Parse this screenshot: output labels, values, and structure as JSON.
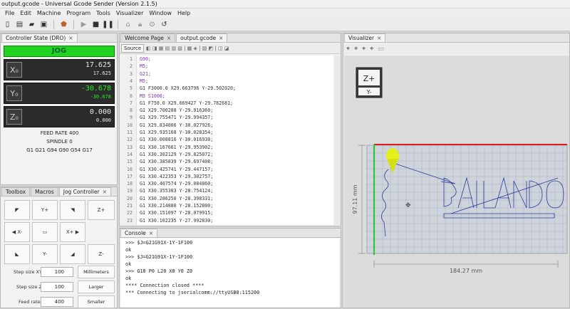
{
  "window": {
    "title": "output.gcode - Universal Gcode Sender (Version 2.1.5)"
  },
  "menu": [
    "File",
    "Edit",
    "Machine",
    "Program",
    "Tools",
    "Visualizer",
    "Window",
    "Help"
  ],
  "toolbar_icons": [
    "new-file-icon",
    "open-file-icon",
    "open-folder-icon",
    "save-icon",
    "stop-sign-icon",
    "play-icon",
    "stop-icon",
    "pause-icon",
    "home-icon",
    "lock-icon",
    "unlock-icon",
    "reset-icon"
  ],
  "controller": {
    "tab": "Controller State (DRO)",
    "state": "JOG",
    "axes": [
      {
        "label": "X₀",
        "work": "17.625",
        "machine": "17.625"
      },
      {
        "label": "Y₀",
        "work": "-30.678",
        "machine": "-30.678"
      },
      {
        "label": "Z₀",
        "work": "0.000",
        "machine": "0.000"
      }
    ],
    "feed_rate_label": "FEED RATE",
    "feed_rate": "400",
    "spindle_label": "SPINDLE",
    "spindle": "0",
    "gcode_state": "G1 G21 G94 G90 G54 G17",
    "colors": {
      "state_bg": "#21d421",
      "work_x": "#e8e8e8",
      "work_y": "#22ee22"
    }
  },
  "jog": {
    "tabs": [
      "Toolbox",
      "Macros",
      "Jog Controller"
    ],
    "buttons": {
      "y_plus": "Y+",
      "z_plus": "Z+",
      "x_minus": "X-",
      "x_plus": "X+",
      "y_minus": "Y-",
      "z_minus": "Z-"
    },
    "step_xy_label": "Step size XY",
    "step_xy": "100",
    "step_z_label": "Step size Z",
    "step_z": "100",
    "feed_label": "Feed rate",
    "feed": "400",
    "units_button": "Millimeters",
    "larger_button": "Larger",
    "smaller_button": "Smaller"
  },
  "editor": {
    "tabs": [
      "Welcome Page",
      "output.gcode"
    ],
    "source_label": "Source",
    "lines": [
      {
        "n": "1",
        "code": "G90;",
        "c": "#7a2fa8"
      },
      {
        "n": "2",
        "code": "M5;",
        "c": "#7a2fa8"
      },
      {
        "n": "3",
        "code": "G21;",
        "c": "#7a2fa8"
      },
      {
        "n": "4",
        "code": "M5;",
        "c": "#7a2fa8"
      },
      {
        "n": "5",
        "code": "G1 F3000.0 X29.663796 Y-29.502020;",
        "c": "#333"
      },
      {
        "n": "6",
        "code": "M3 S1000;",
        "c": "#7a2fa8"
      },
      {
        "n": "7",
        "code": "G1 F750.0 X29.669427 Y-29.782681;",
        "c": "#333"
      },
      {
        "n": "8",
        "code": "G1 X29.700288 Y-29.916360;",
        "c": "#333"
      },
      {
        "n": "9",
        "code": "G1 X29.755471 Y-29.994357;",
        "c": "#333"
      },
      {
        "n": "10",
        "code": "G1 X29.834006 Y-30.027926;",
        "c": "#333"
      },
      {
        "n": "11",
        "code": "G1 X29.935168 Y-30.028354;",
        "c": "#333"
      },
      {
        "n": "12",
        "code": "G1 X30.008816 Y-30.016930;",
        "c": "#333"
      },
      {
        "n": "13",
        "code": "G1 X30.167661 Y-29.953902;",
        "c": "#333"
      },
      {
        "n": "14",
        "code": "G1 X30.302129 Y-29.825072;",
        "c": "#333"
      },
      {
        "n": "15",
        "code": "G1 X30.385839 Y-29.697408;",
        "c": "#333"
      },
      {
        "n": "16",
        "code": "G1 X30.425741 Y-29.447157;",
        "c": "#333"
      },
      {
        "n": "17",
        "code": "G1 X30.422353 Y-29.302757;",
        "c": "#333"
      },
      {
        "n": "18",
        "code": "G1 X30.407574 Y-29.084860;",
        "c": "#333"
      },
      {
        "n": "19",
        "code": "G1 X30.355303 Y-28.754124;",
        "c": "#333"
      },
      {
        "n": "20",
        "code": "G1 X30.286250 Y-28.398331;",
        "c": "#333"
      },
      {
        "n": "21",
        "code": "G1 X30.214880 Y-28.152800;",
        "c": "#333"
      },
      {
        "n": "22",
        "code": "G1 X30.151097 Y-28.079915;",
        "c": "#333"
      },
      {
        "n": "23",
        "code": "G1 X30.102235 Y-27.992830;",
        "c": "#333"
      }
    ]
  },
  "console": {
    "tab": "Console",
    "lines": [
      ">>> $J=G21G91X-1Y-1F100",
      "ok",
      ">>> $J=G21G91X-1Y-1F100",
      "ok",
      ">>> G10 P0 L20 X0 Y0 Z0",
      "ok",
      "**** Connection closed ****",
      "*** Connecting to jserialcomm://ttyUSB0:115200"
    ]
  },
  "visualizer": {
    "tab": "Visualizer",
    "cube_top": "Z+",
    "cube_front": "Y-",
    "width_dim": "184.27 mm",
    "height_dim": "97.11 mm",
    "drawing_text": "BAILANDO"
  }
}
